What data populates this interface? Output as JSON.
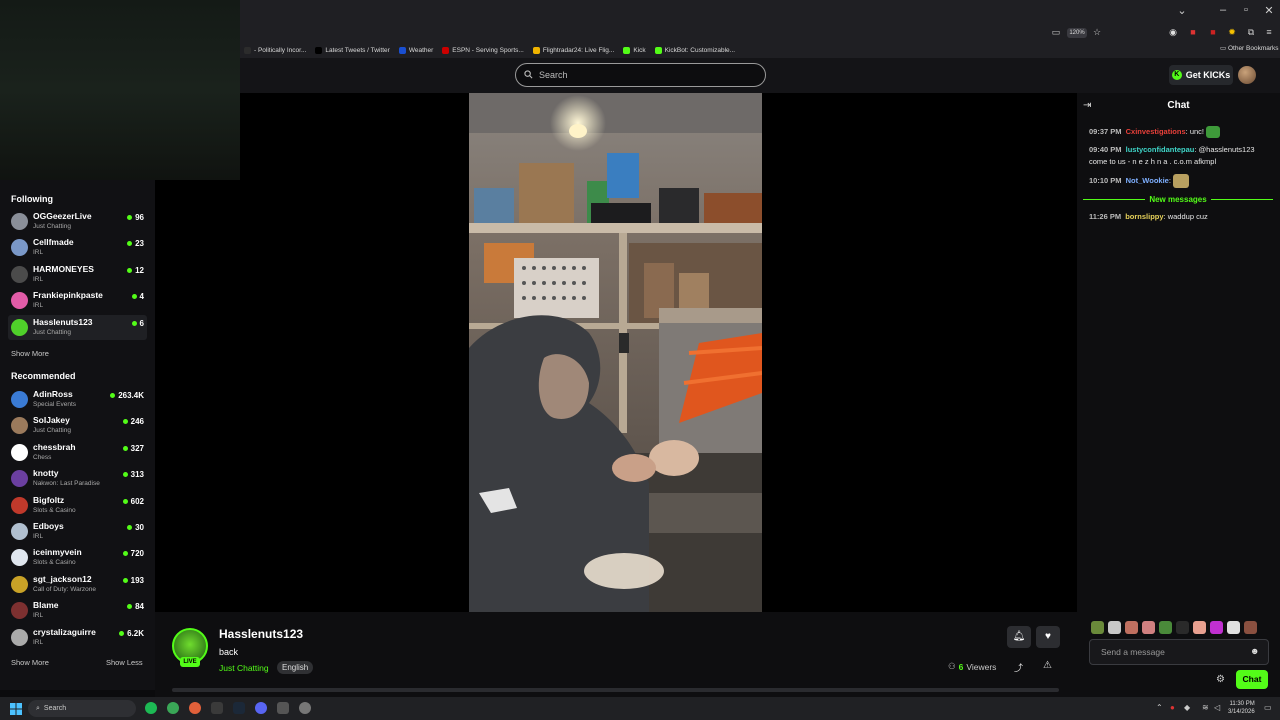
{
  "browser": {
    "zoom": "120%",
    "bookmarks": [
      {
        "label": "- Politically Incor...",
        "color": "#2c2c2c"
      },
      {
        "label": "Latest Tweets / Twitter",
        "color": "#000000"
      },
      {
        "label": "Weather",
        "color": "#1a4fd1"
      },
      {
        "label": "ESPN - Serving Sports...",
        "color": "#cc0000"
      },
      {
        "label": "Flightradar24: Live Flig...",
        "color": "#f0b400"
      },
      {
        "label": "Kick",
        "color": "#53fc18"
      },
      {
        "label": "KickBot: Customizable...",
        "color": "#53fc18"
      }
    ],
    "other_bookmarks": "Other Bookmarks"
  },
  "header": {
    "search_placeholder": "Search",
    "get_kicks": "Get KICKs"
  },
  "sidebar": {
    "following_title": "Following",
    "following": [
      {
        "name": "OGGeezerLive",
        "category": "Just Chatting",
        "viewers": "96",
        "color": "#8a8f99"
      },
      {
        "name": "Cellfmade",
        "category": "IRL",
        "viewers": "23",
        "color": "#7a98c8"
      },
      {
        "name": "HARMONEYES",
        "category": "IRL",
        "viewers": "12",
        "color": "#4b4b4b"
      },
      {
        "name": "Frankiepinkpaste",
        "category": "IRL",
        "viewers": "4",
        "color": "#e25ca8"
      },
      {
        "name": "Hasslenuts123",
        "category": "Just Chatting",
        "viewers": "6",
        "color": "#4fd02a"
      }
    ],
    "show_more_1": "Show More",
    "recommended_title": "Recommended",
    "recommended": [
      {
        "name": "AdinRoss",
        "category": "Special Events",
        "viewers": "263.4K",
        "color": "#3a7bd5"
      },
      {
        "name": "SoIJakey",
        "category": "Just Chatting",
        "viewers": "246",
        "color": "#9b7a5c"
      },
      {
        "name": "chessbrah",
        "category": "Chess",
        "viewers": "327",
        "color": "#ffffff"
      },
      {
        "name": "knotty",
        "category": "Nakwon: Last Paradise",
        "viewers": "313",
        "color": "#6b3fa0"
      },
      {
        "name": "Bigfoltz",
        "category": "Slots & Casino",
        "viewers": "602",
        "color": "#c0392b"
      },
      {
        "name": "Edboys",
        "category": "IRL",
        "viewers": "30",
        "color": "#b0bfcf"
      },
      {
        "name": "iceinmyvein",
        "category": "Slots & Casino",
        "viewers": "720",
        "color": "#dfe6ee"
      },
      {
        "name": "sgt_jackson12",
        "category": "Call of Duty: Warzone",
        "viewers": "193",
        "color": "#c9a227"
      },
      {
        "name": "Blame",
        "category": "IRL",
        "viewers": "84",
        "color": "#7d3030"
      },
      {
        "name": "crystalizaguirre",
        "category": "IRL",
        "viewers": "6.2K",
        "color": "#aaaaaa"
      }
    ],
    "show_more_2": "Show More",
    "show_less": "Show Less"
  },
  "stream": {
    "live": "LIVE",
    "name": "Hasslenuts123",
    "title": "back",
    "category": "Just Chatting",
    "language": "English",
    "viewers_count": "6",
    "viewers_label": "Viewers"
  },
  "chat": {
    "title": "Chat",
    "messages": [
      {
        "time": "09:37 PM",
        "user": "Cxinvestigations",
        "user_color": "#e8403a",
        "text": "unc!"
      },
      {
        "time": "09:40 PM",
        "user": "lustyconfidantepau",
        "user_color": "#3fd6c9",
        "text": "@hasslenuts123 come to us - n e z h n a . c.o.m afkmpl"
      },
      {
        "time": "10:10 PM",
        "user": "Not_Wookie",
        "user_color": "#7fb0ff",
        "text": ""
      },
      {
        "time": "11:26 PM",
        "user": "bornslippy",
        "user_color": "#e6d15a",
        "text": "waddup cuz"
      }
    ],
    "new_messages": "New messages",
    "input_placeholder": "Send a message",
    "send_label": "Chat"
  },
  "taskbar": {
    "search": "Search",
    "time": "11:30 PM",
    "date": "3/14/2026"
  }
}
